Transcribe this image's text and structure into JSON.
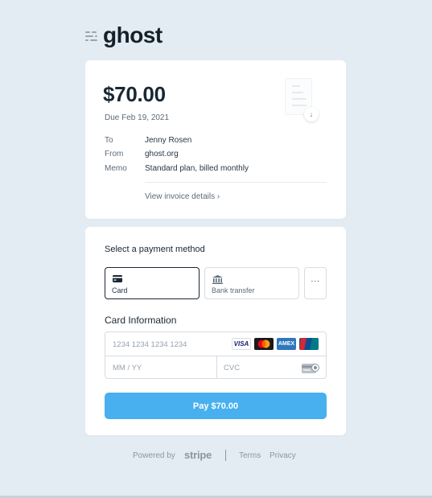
{
  "brand": {
    "logo_text": "ghost",
    "accent_color": "#48b0ee"
  },
  "invoice": {
    "amount": "$70.00",
    "due_date": "Due Feb 19, 2021",
    "details": [
      {
        "label": "To",
        "value": "Jenny Rosen"
      },
      {
        "label": "From",
        "value": "ghost.org"
      },
      {
        "label": "Memo",
        "value": "Standard plan, billed monthly"
      }
    ],
    "view_details_link": "View invoice details",
    "download_icon": "download-icon"
  },
  "payment": {
    "title": "Select a payment method",
    "methods": [
      {
        "label": "Card",
        "icon": "credit-card-icon",
        "selected": true
      },
      {
        "label": "Bank transfer",
        "icon": "bank-icon",
        "selected": false
      }
    ],
    "more_label": "···",
    "card_info_title": "Card Information",
    "card_number_placeholder": "1234 1234 1234 1234",
    "expiry_placeholder": "MM / YY",
    "cvc_placeholder": "CVC",
    "brands": [
      "VISA",
      "Mastercard",
      "American Express",
      "UnionPay"
    ],
    "brand_visa_text": "VISA",
    "brand_amex_text": "AMEX",
    "pay_button_label": "Pay $70.00"
  },
  "footer": {
    "powered_by": "Powered by",
    "stripe": "stripe",
    "terms": "Terms",
    "privacy": "Privacy"
  }
}
